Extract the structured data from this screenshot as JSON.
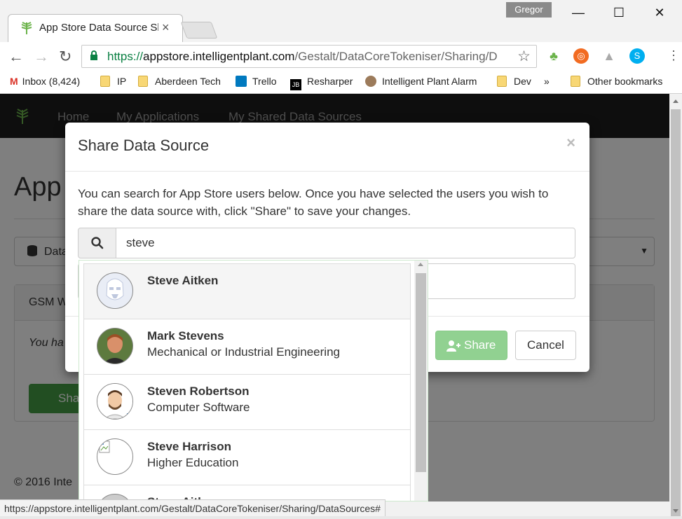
{
  "browser": {
    "tab_title": "App Store Data Source Sh",
    "tab_close": "×",
    "profile_name": "Gregor",
    "url_scheme": "https://",
    "url_host": "appstore.intelligentplant.com",
    "url_path": "/Gestalt/DataCoreTokeniser/Sharing/D",
    "status_url": "https://appstore.intelligentplant.com/Gestalt/DataCoreTokeniser/Sharing/DataSources#",
    "bookmarks": [
      {
        "label": "Inbox (8,424)",
        "icon": "gmail-icon"
      },
      {
        "label": "IP",
        "icon": "folder-icon"
      },
      {
        "label": "Aberdeen Tech",
        "icon": "folder-icon"
      },
      {
        "label": "Trello",
        "icon": "trello-icon"
      },
      {
        "label": "Resharper",
        "icon": "jetbrains-icon"
      },
      {
        "label": "Intelligent Plant Alarm",
        "icon": "site-icon"
      },
      {
        "label": "Dev",
        "icon": "folder-icon"
      },
      {
        "label": "»",
        "icon": ""
      },
      {
        "label": "Other bookmarks",
        "icon": "folder-icon"
      }
    ]
  },
  "app_nav": {
    "links": [
      "Home",
      "My Applications",
      "My Shared Data Sources"
    ]
  },
  "background": {
    "page_title": "App",
    "select_label": "Data",
    "panel_title": "GSM W",
    "panel_text": "You ha",
    "share_button": "Sha",
    "footer": "© 2016 Inte"
  },
  "modal": {
    "title": "Share Data Source",
    "close": "×",
    "description": "You can search for App Store users below. Once you have selected the users you wish to share the data source with, click \"Share\" to save your changes.",
    "search_value": "steve",
    "share_button": "Share",
    "cancel_button": "Cancel"
  },
  "results": [
    {
      "name": "Steve Aitken",
      "subtitle": "",
      "avatar": "stormtrooper-avatar"
    },
    {
      "name": "Mark Stevens",
      "subtitle": "Mechanical or Industrial Engineering",
      "avatar": "photo-avatar"
    },
    {
      "name": "Steven Robertson",
      "subtitle": "Computer Software",
      "avatar": "cartoon-avatar"
    },
    {
      "name": "Steve Harrison",
      "subtitle": "Higher Education",
      "avatar": "broken-image-avatar"
    },
    {
      "name": "Steve Aitken",
      "subtitle": "",
      "avatar": "photo-avatar"
    }
  ],
  "colors": {
    "navbar": "#1c1c1c",
    "share_disabled": "#91d191",
    "share_bg": "#449d44",
    "url_scheme": "#0b8043"
  }
}
